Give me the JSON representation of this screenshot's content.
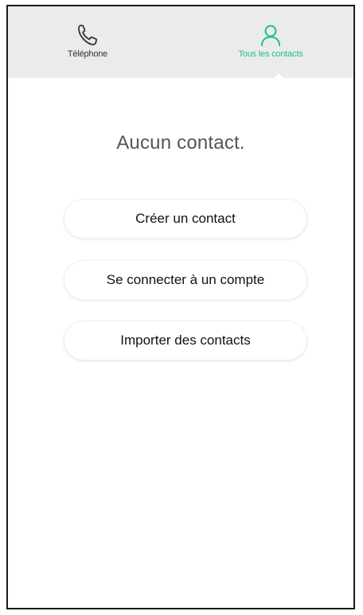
{
  "tabs": {
    "phone": {
      "label": "Téléphone",
      "icon": "phone-icon",
      "color": "#333333"
    },
    "contacts": {
      "label": "Tous les contacts",
      "icon": "person-icon",
      "color": "#1fbf90",
      "active": true
    }
  },
  "main": {
    "empty_message": "Aucun contact.",
    "buttons": {
      "create": "Créer un contact",
      "connect": "Se connecter à un compte",
      "import": "Importer des contacts"
    }
  },
  "colors": {
    "accent": "#1fbf90",
    "tab_bar_bg": "#ebebeb"
  }
}
